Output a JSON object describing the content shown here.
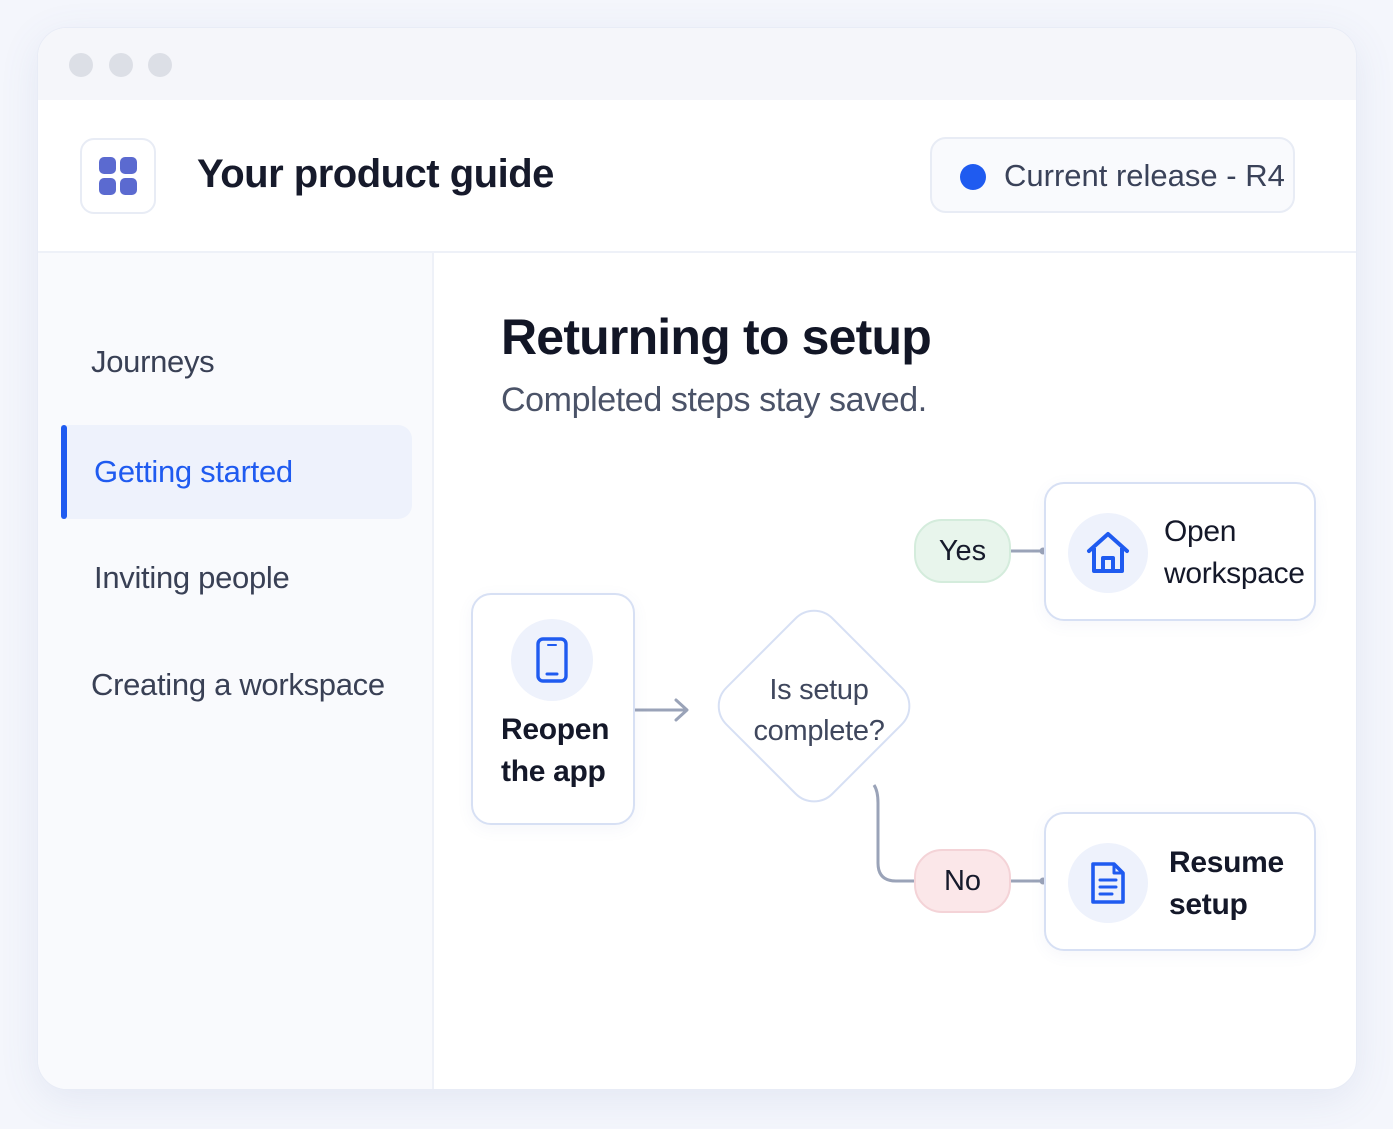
{
  "header": {
    "title": "Your product guide",
    "release_label": "Current release - R4"
  },
  "sidebar": {
    "items": [
      {
        "label": "Journeys",
        "active": false
      },
      {
        "label": "Getting started",
        "active": true
      },
      {
        "label": "Inviting people",
        "active": false
      },
      {
        "label": "Creating a workspace",
        "active": false
      }
    ]
  },
  "main": {
    "title": "Returning to setup",
    "subtitle": "Completed steps stay saved."
  },
  "flow": {
    "start": {
      "line1": "Reopen",
      "line2": "the app",
      "icon": "phone-icon"
    },
    "decision": {
      "line1": "Is setup",
      "line2": "complete?"
    },
    "yes_label": "Yes",
    "no_label": "No",
    "yes_target": {
      "line1": "Open",
      "line2": "workspace",
      "icon": "home-icon"
    },
    "no_target": {
      "line1": "Resume",
      "line2": "setup",
      "icon": "document-icon"
    }
  },
  "colors": {
    "accent": "#1f5bf0",
    "app_icon": "#5b6ad0",
    "yes_pill": "#e8f5ec",
    "no_pill": "#fbe7e9",
    "connector": "#9aa3b8"
  }
}
